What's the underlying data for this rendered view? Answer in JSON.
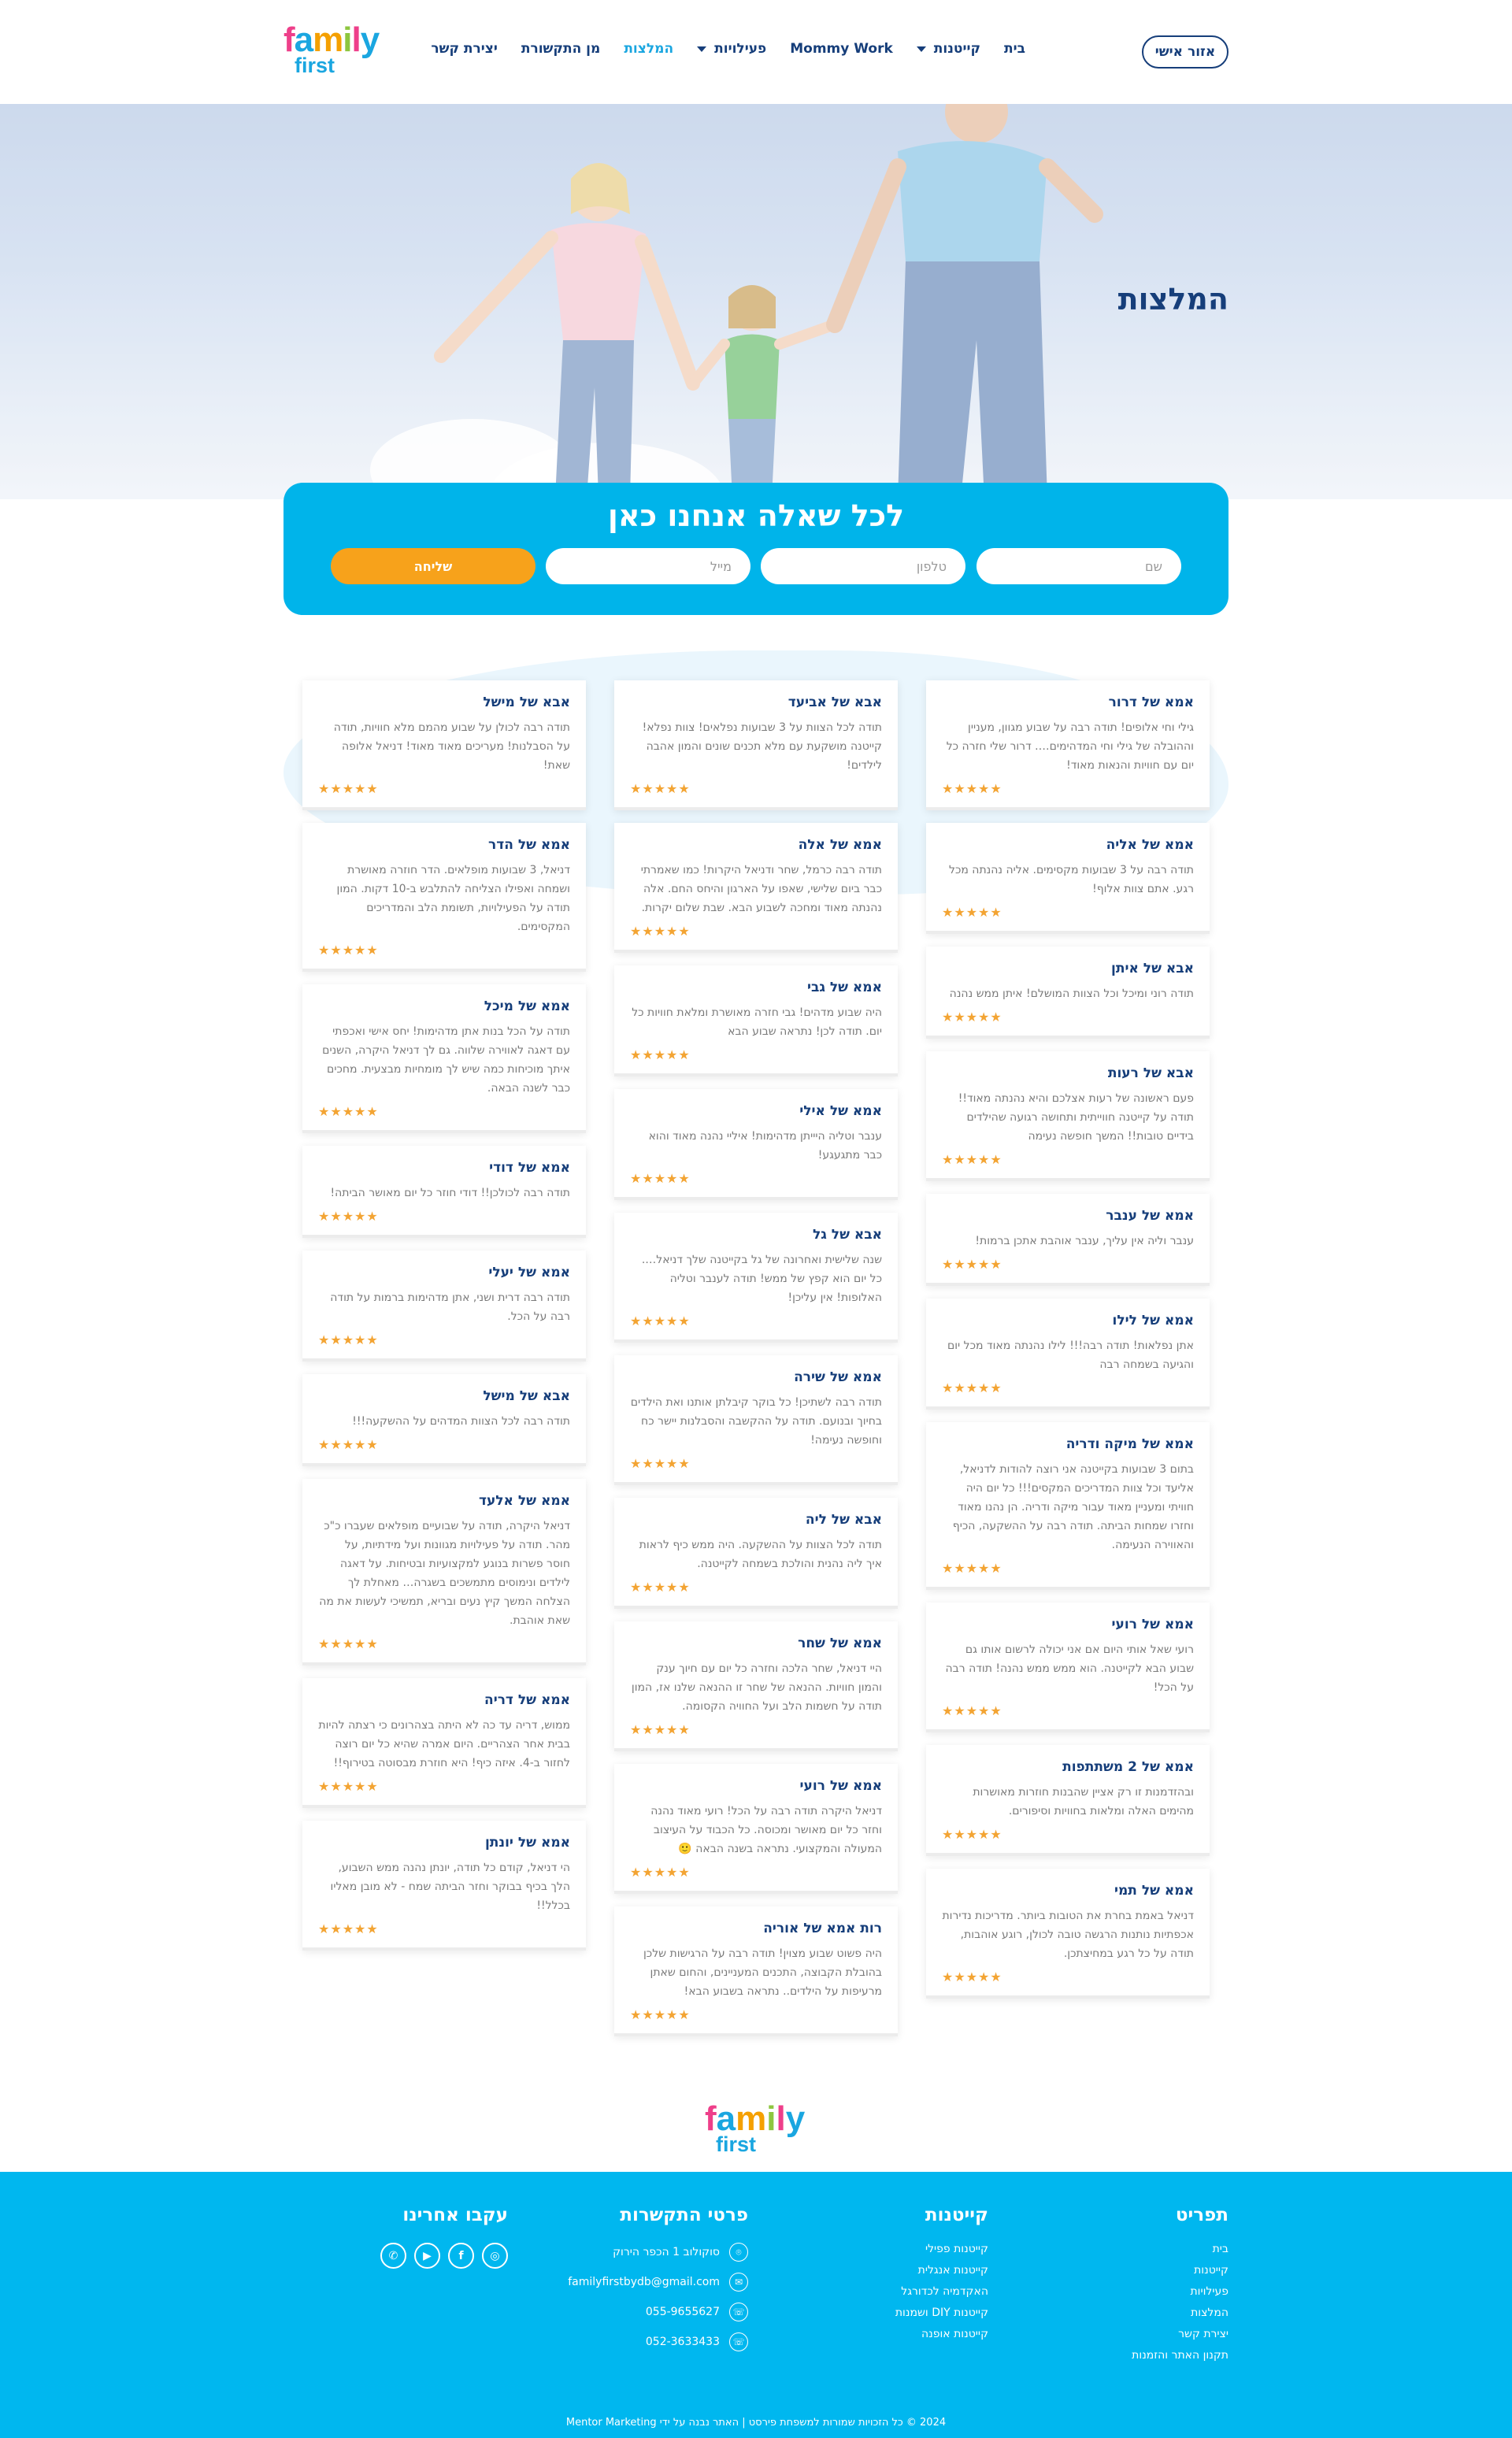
{
  "header": {
    "logo_line1": "family",
    "logo_line2": "first",
    "login_label": "אזור אישי",
    "nav": [
      {
        "label": "בית"
      },
      {
        "label": "קייטנות"
      },
      {
        "label": "Mommy Work"
      },
      {
        "label": "פעילויות"
      },
      {
        "label": "המלצות"
      },
      {
        "label": "מן התקשורת"
      },
      {
        "label": "יצירת קשר"
      }
    ]
  },
  "hero": {
    "title": "המלצות"
  },
  "contact_form": {
    "title": "לכל שאלה אנחנו כאן",
    "name_placeholder": "שם",
    "phone_placeholder": "טלפון",
    "email_placeholder": "מייל",
    "submit_label": "שליחה"
  },
  "stars": "★★★★★",
  "testimonials": {
    "col_right": [
      {
        "name": "אמא של דרור",
        "text": "גילי וחי אלופים! תודה רבה על שבוע מגוון, מעניין וההובלה של גילי וחי המדהימים…. דרור שלי חזרה כל יום עם חוויות והנאות מאוד!"
      },
      {
        "name": "אמא של אליה",
        "text": "תודה רבה על 3 שבועות מקסימים. אליה נהנתה מכל רגע. אתם צוות אלוף!"
      },
      {
        "name": "אבא של איתן",
        "text": "תודה רוני ומיכל וכל הצוות המושלם! איתן ממש נהנה"
      },
      {
        "name": "אבא של רעות",
        "text": "פעם ראשונה של רעות אצלכם והיא נהנתה מאוד!! תודה על קייטנה חווייתית ותחושה רגועה שהילדים בידיים טובות!! המשך חופשה נעימה"
      },
      {
        "name": "אמא של ענבר",
        "text": "ענבר וליה אין עליך, ענבר אוהבת אתכן ברמות!"
      },
      {
        "name": "אמא של לילו",
        "text": "אתן נפלאות! תודה רבה!!! לילו נהנתה מאוד מכל יום והגיעה בשמחה רבה"
      },
      {
        "name": "אמא של מיקה ודריה",
        "text": "בתום 3 שבועות בקייטנה אני רוצה להודות לדניאל, אליעד וכל צוות המדריכים המקסים!!! כל יום היה חוויתי ומעניין מאוד עבור מיקה ודריה. הן נהנו מאוד וחזרו שמחות הביתה. תודה רבה על ההשקעה, הכיף והאווירה הנעימה."
      },
      {
        "name": "אמא של רועי",
        "text": "רועי שאל אותי היום אם אני יכולה לרשום אותו גם שבוע הבא לקייטנה. הוא ממש ממש נהנה! תודה רבה על הכל!"
      },
      {
        "name": "אמא של 2 משתתפות",
        "text": "ובהזדמנות זו רק אציין שהבנות חוזרות מאושרות מהימים האלה ומלאות בחוויות וסיפורים."
      },
      {
        "name": "אמא של תמי",
        "text": "דניאל באמת בחרת את הטובות ביותר. מדריכות נדירות אכפתיות נותנות הרגשה טובה לכולן, רוגע אוהבות, תודה על כל רגע במחיצתכן."
      }
    ],
    "col_middle": [
      {
        "name": "אבא של אביעד",
        "text": "תודה לכל הצוות על 3 שבועות נפלאים! צוות נפלא! קייטנה מושקעת עם מלא תכנים שונים והמון אהבה לילדים!"
      },
      {
        "name": "אמא של אלה",
        "text": "תודה רבה כרמל, שחר ודניאל היקרות! כמו שאמרתי כבר ביום שלישי, שאפו על הארגון והיחס החם. אלה נהנתה מאוד ומחכה לשבוע הבא. שבת שלום יקרות."
      },
      {
        "name": "אמא של גבי",
        "text": "היה שבוע מדהים! גבי חזרה מאושרת ומלאת חוויות כל יום. תודה לכן! נתראה שבוע הבא"
      },
      {
        "name": "אמא של אילי",
        "text": "ענבר וטליה היייתן מדהימות! איליי נהנה מאוד והוא כבר מתגעגע!"
      },
      {
        "name": "אבא של גל",
        "text": "שנה שלישית ואחרונה של גל בקייטנה שלך דניאל…. כל יום הוא קפץ של ממש! תודה לענבר וטליה האלופות! אין עליכן!"
      },
      {
        "name": "אמא של שירה",
        "text": "תודה רבה לשתיכן! כל בוקר קיבלתן אותנו ואת הילדים בחיוך ובנועם. תודה על ההקשבה והסבלנות יישר כח וחופשה נעימה!"
      },
      {
        "name": "אבא של ליה",
        "text": "תודה לכל הצוות על ההשקעה. היה ממש כיף לראות איך ליה נהנית והולכת בשמחה לקייטנה."
      },
      {
        "name": "אמא של שחר",
        "text": "היי דניאל, שחר הלכה וחזרה כל יום עם חיוך ענק והמון חוויות. ההנאה של שחר זו ההנאה שלנו אז, המון תודה על חשמות הלב ועל החוויה הקסומה."
      },
      {
        "name": "אמא של רועי",
        "text": "דניאל היקרה תודה רבה על הכל! רועי מאוד נהנה וחזר כל יום מאושר ומכוסה. כל הכבוד על העיצוב המעולה והמקצועי. נתראה בשנה הבאה 🙂"
      },
      {
        "name": "רות אמא של אוריה",
        "text": "היה פשוט שבוע מצוין! תודה רבה על הרגישות שלכן בהובלת הקבוצה, התכנים המעניינים, והחום שאתן מרעיפות על הילדים.. נתראה בשבוע הבא!"
      }
    ],
    "col_left": [
      {
        "name": "אבא של מישל",
        "text": "תודה רבה לכולן על שבוע מהמם מלא חוויות, תודה על הסבלנות! מעריכים מאוד מאוד! דניאל אלופה שאת!"
      },
      {
        "name": "אמא של הדר",
        "text": "דניאל, 3 שבועות מופלאים. הדר חוזרה מאושרת ושמחה ואפילו הצליחה להתלבש ב-10 דקות. המון תודה על הפעילויות, תשומת הלב והמדריכים המקסימים."
      },
      {
        "name": "אמא של מיכל",
        "text": "תודה על הכל בנות אתן מדהימות! יחס אישי ואכפתי עם דאגה לאווירה שלווה. גם לך דניאל היקרה, השנים איתך מוכיחות כמה שיש לך מומחיות מבצעית. מחכים כבר לשנה הבאה."
      },
      {
        "name": "אמא של דודי",
        "text": "תודה רבה לכולכן!! דודי חוזר כל יום מאושר הביתה!"
      },
      {
        "name": "אמא של יעלי",
        "text": "תודה רבה דרית ושני, אתן מדהימות ברמות על תודה רבה על הכל."
      },
      {
        "name": "אבא של מישל",
        "text": "תודה רבה לכל הצוות המדהים על ההשקעה!!!"
      },
      {
        "name": "אמא של אלעד",
        "text": "דניאל היקרה, תודה על שבועיים מופלאים שעברו כ\"כ מהר. תודה על פעילויות מגוונות ועל מידתיות, על חוסר פשרות בנוגע למקצועיות ובטיחות. על דאגה לילדים ונימוסים מתמשכים בשגרה… מאחלת לך הצלחה המשך קיץ נעים ובריא, תמשיכי לעשות את מה שאת אוהבת."
      },
      {
        "name": "אמא של דריה",
        "text": "ממוש, דריה עד כה לא היתה בצהרונים כי רצתה להיות בבית אחר הצהריים. היום אמרה שהיא כל יום רוצה לחזור ב-4. איזה כיף! היא חוזרת מבסוטה בטירוף!!"
      },
      {
        "name": "אמא של יונתן",
        "text": "הי דניאל, קודם כל תודה, יונתן נהנה ממש השבוע, הלך בכיף בבוקר וחזר הביתה שמח - לא מובן מאליו בכלל!!"
      }
    ]
  },
  "footer": {
    "logo_line1": "family",
    "logo_line2": "first",
    "sitemap": {
      "title": "תפריט",
      "links": [
        "בית",
        "קייטנות",
        "פעילויות",
        "המלצות",
        "יצירת קשר",
        "תקנון האתר והזמנות"
      ]
    },
    "camps": {
      "title": "קייטנות",
      "links": [
        "קייטנות פפילי",
        "קייטנות אנגלית",
        "האקדמיה לכדורגל",
        "קייטנות DIY ושמנות",
        "קייטנות אופנה"
      ]
    },
    "contact": {
      "title": "פרטי התקשרות",
      "address": "סוקולוב 1 הכפר הירוק",
      "email": "familyfirstbydb@gmail.com",
      "phone1": "055-9655627",
      "phone2": "052-3633433"
    },
    "social": {
      "title": "עקבו אחרינו"
    },
    "copyright": "2024 © כל הזכויות שמורות למשפחת פירסט | האתר נבנה על ידי Mentor Marketing"
  }
}
